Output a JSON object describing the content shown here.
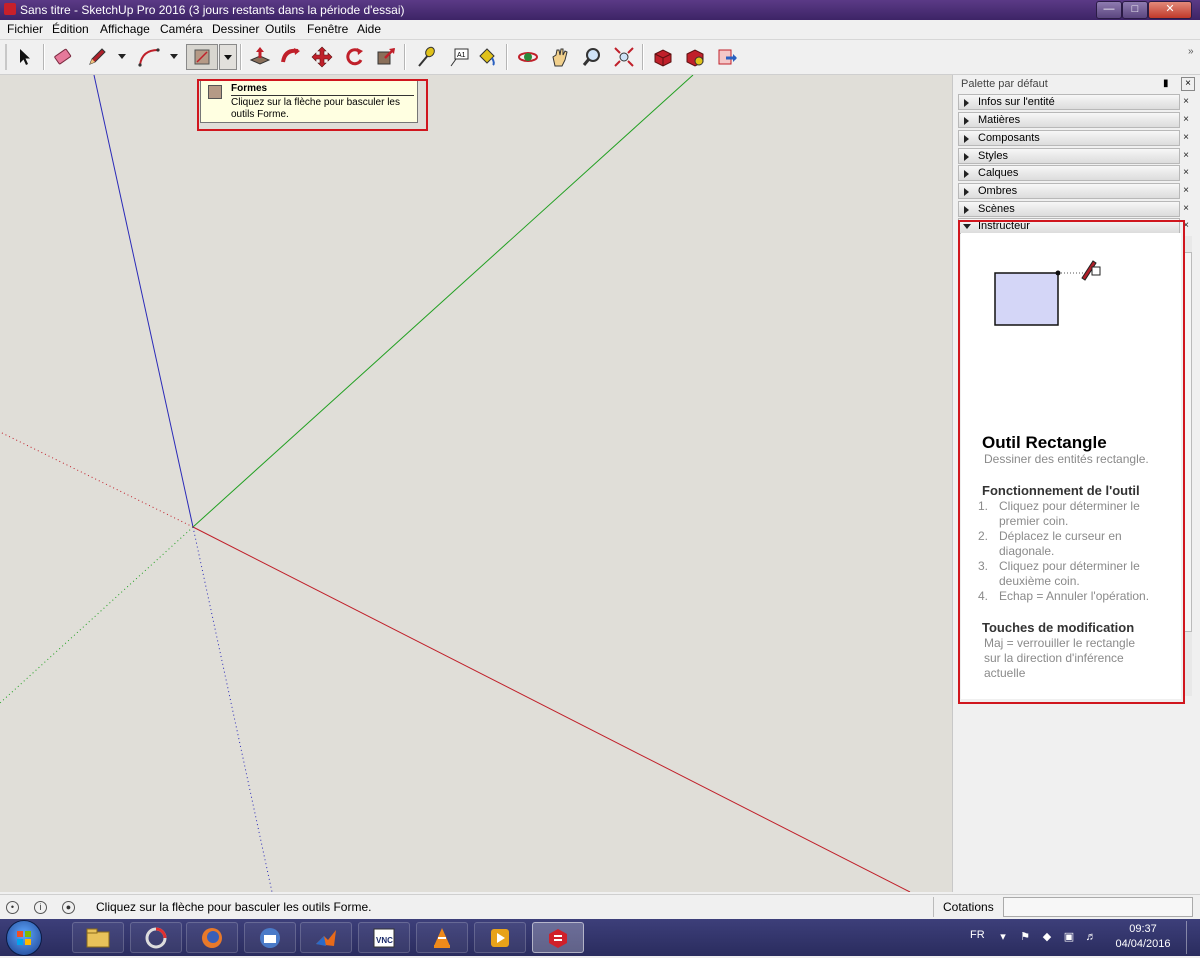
{
  "window": {
    "title": "Sans titre - SketchUp Pro 2016 (3 jours restants dans la période d'essai)",
    "buttons": [
      "minimize",
      "maximize",
      "close"
    ]
  },
  "menu": [
    "Fichier",
    "Édition",
    "Affichage",
    "Caméra",
    "Dessiner",
    "Outils",
    "Fenêtre",
    "Aide"
  ],
  "toolbar": {
    "tools": [
      "select-icon",
      "eraser-icon",
      "pencil-icon",
      "arc-icon",
      "shapes-icon",
      "push-pull-icon",
      "follow-me-icon",
      "move-icon",
      "rotate-icon",
      "scale-icon",
      "tape-measure-icon",
      "text-icon",
      "paint-bucket-icon",
      "orbit-icon",
      "pan-icon",
      "zoom-icon",
      "zoom-extents-icon",
      "3d-warehouse-icon",
      "extension-warehouse-icon",
      "layout-send-icon"
    ],
    "active": "shapes-icon"
  },
  "tooltip": {
    "title": "Formes",
    "text": "Cliquez sur la flèche pour basculer les outils Forme."
  },
  "panel": {
    "title": "Palette par défaut",
    "trays": [
      "Infos sur l'entité",
      "Matières",
      "Composants",
      "Styles",
      "Calques",
      "Ombres",
      "Scènes",
      "Instructeur"
    ],
    "close_glyph": "×"
  },
  "instructor": {
    "title": "Outil Rectangle",
    "subtitle": "Dessiner des entités rectangle.",
    "section1": "Fonctionnement de l'outil",
    "steps": [
      {
        "n": "1.",
        "line1": "Cliquez pour déterminer le",
        "line2": "premier coin."
      },
      {
        "n": "2.",
        "line1": "Déplacez le curseur en",
        "line2": "diagonale."
      },
      {
        "n": "3.",
        "line1": "Cliquez pour déterminer le",
        "line2": "deuxième coin."
      },
      {
        "n": "4.",
        "line1": "Echap = Annuler l'opération.",
        "line2": ""
      }
    ],
    "section2": "Touches de modification",
    "modifier": {
      "line1": "Maj = verrouiller le rectangle",
      "line2": "sur la direction d'inférence",
      "line3": "actuelle"
    }
  },
  "status": {
    "message": "Cliquez sur la flèche pour basculer les outils Forme.",
    "measure_label": "Cotations",
    "measure_value": ""
  },
  "taskbar": {
    "apps": [
      "start-orb",
      "explorer-icon",
      "app-icon",
      "firefox-icon",
      "thunderbird-icon",
      "matlab-icon",
      "vnc-icon",
      "vlc-icon",
      "media-player-icon",
      "sketchup-icon"
    ],
    "language": "FR",
    "time": "09:37",
    "date": "04/04/2016"
  },
  "colors": {
    "highlight": "#d0161e",
    "axis_red": "#c0202a",
    "axis_green": "#22a022",
    "axis_blue": "#2a2ab8",
    "canvas": "#e0ded8"
  }
}
